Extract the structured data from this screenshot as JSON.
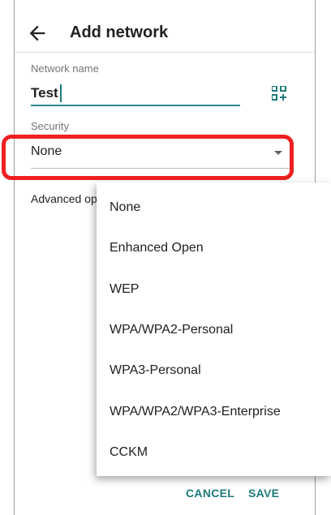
{
  "header": {
    "title": "Add network"
  },
  "network_name": {
    "label": "Network name",
    "value": "Test"
  },
  "security": {
    "label": "Security",
    "value": "None"
  },
  "advanced": {
    "label": "Advanced opti"
  },
  "actions": {
    "cancel": "CANCEL",
    "save": "SAVE"
  },
  "menu": {
    "items": [
      "None",
      "Enhanced Open",
      "WEP",
      "WPA/WPA2-Personal",
      "WPA3-Personal",
      "WPA/WPA2/WPA3-Enterprise",
      "CCKM"
    ]
  },
  "colors": {
    "accent": "#1e7a7a",
    "highlight": "#ef2020",
    "text": "#212121",
    "secondary": "#757575"
  },
  "icons": {
    "back": "arrow-left-icon",
    "qr": "qr-code-scan-icon",
    "dropdown": "triangle-down-icon"
  }
}
